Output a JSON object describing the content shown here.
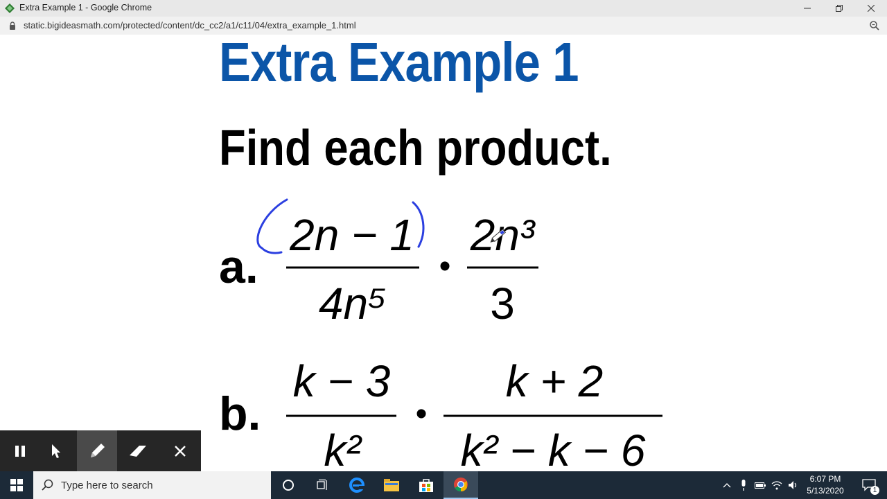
{
  "window": {
    "title": "Extra Example 1 - Google Chrome",
    "minimize_icon": "minimize-icon",
    "restore_icon": "restore-icon",
    "close_icon": "close-icon"
  },
  "address_bar": {
    "url": "static.bigideasmath.com/protected/content/dc_cc2/a1/c11/04/extra_example_1.html",
    "lock_icon": "lock-icon",
    "zoom_icon": "zoom-icon"
  },
  "content": {
    "heading": "Extra Example 1",
    "instruction": "Find each product.",
    "heading_color": "#0b55a8",
    "ink_color": "#2b3fe0",
    "problems": [
      {
        "label": "a.",
        "fraction1": {
          "numerator": "2n − 1",
          "denominator": "4n⁵"
        },
        "operator": "•",
        "fraction2": {
          "numerator": "2n³",
          "denominator": "3"
        }
      },
      {
        "label": "b.",
        "fraction1": {
          "numerator": "k − 3",
          "denominator": "k²"
        },
        "operator": "•",
        "fraction2": {
          "numerator": "k + 2",
          "denominator": "k² − k − 6"
        }
      }
    ]
  },
  "annotation_toolbar": {
    "buttons": [
      {
        "name": "pause",
        "icon": "pause-icon"
      },
      {
        "name": "pointer",
        "icon": "cursor-icon"
      },
      {
        "name": "pen",
        "icon": "pen-icon",
        "active": true
      },
      {
        "name": "eraser",
        "icon": "eraser-icon"
      },
      {
        "name": "close",
        "icon": "close-icon"
      }
    ]
  },
  "taskbar": {
    "search_placeholder": "Type here to search",
    "apps": [
      "cortana-icon",
      "task-view-icon",
      "edge-icon",
      "file-explorer-icon",
      "store-icon",
      "chrome-icon"
    ],
    "tray_icons": [
      "chevron-up-icon",
      "microphone-icon",
      "battery-icon",
      "wifi-icon",
      "volume-icon"
    ],
    "time": "6:07 PM",
    "date": "5/13/2020",
    "notification_count": "1"
  }
}
